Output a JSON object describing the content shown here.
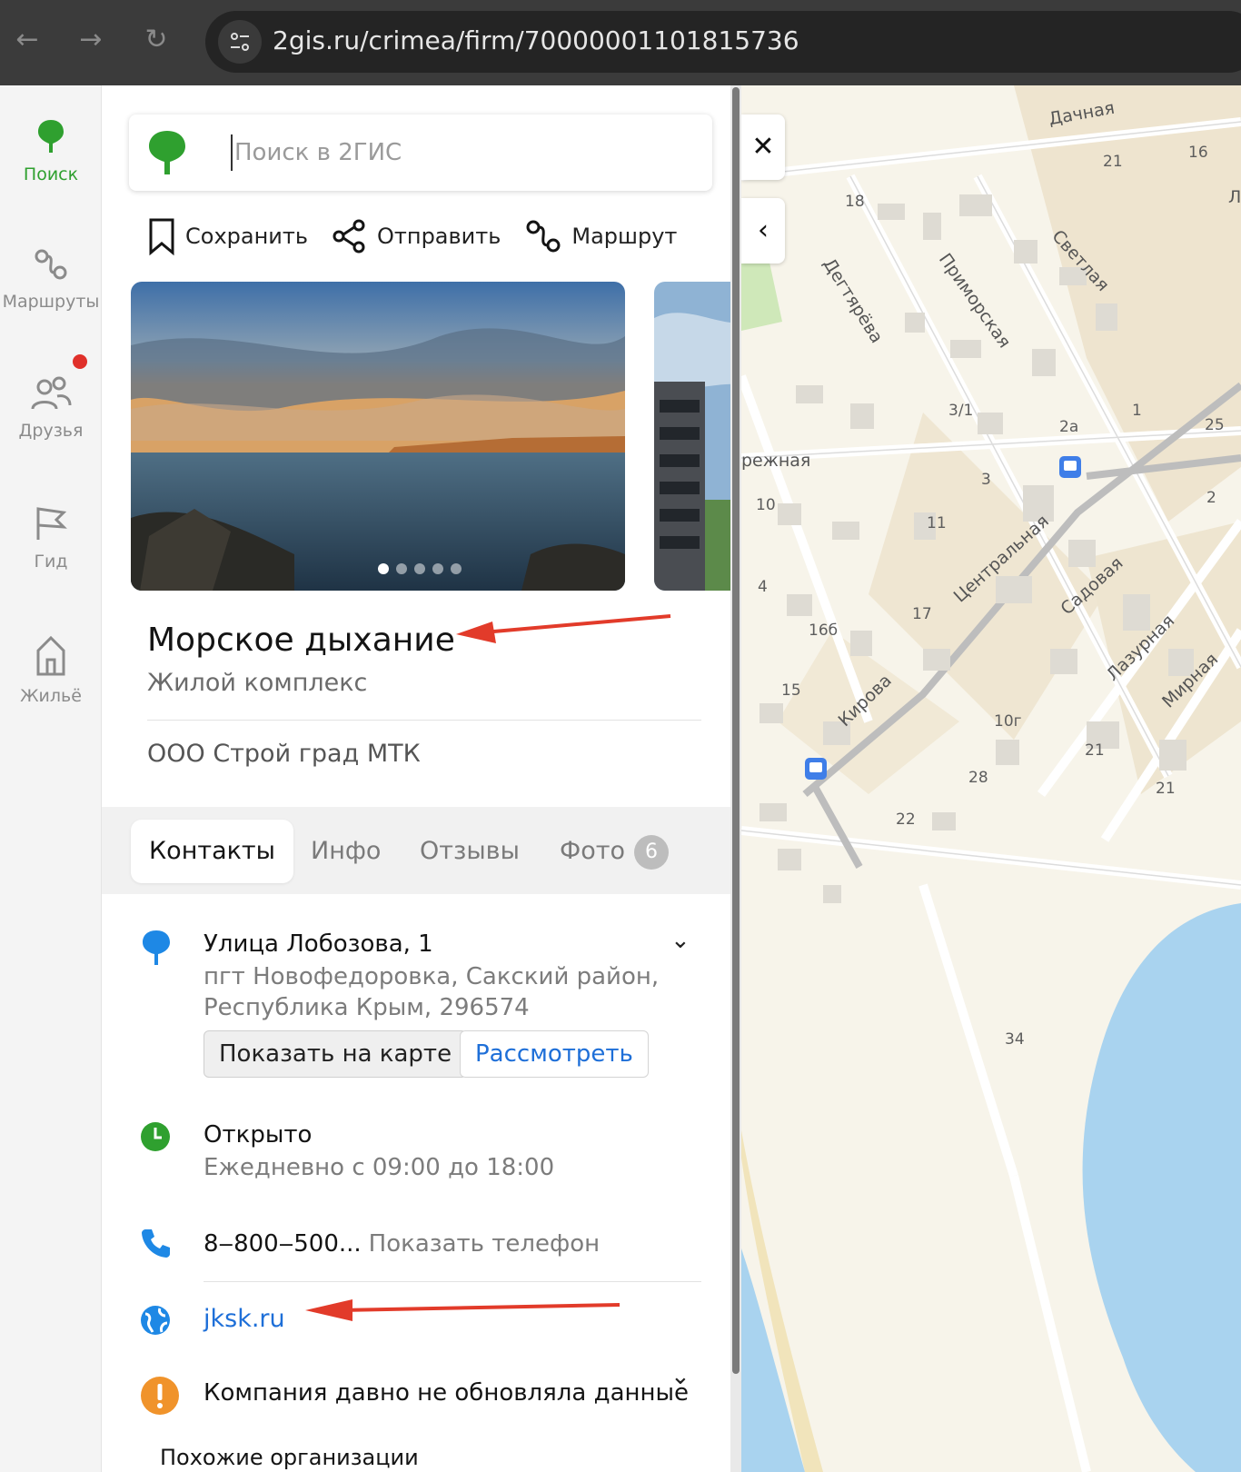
{
  "browser": {
    "url": "2gis.ru/crimea/firm/70000001101815736"
  },
  "rail": {
    "items": [
      {
        "label": "Поиск",
        "icon": "map-pin-icon",
        "active": true
      },
      {
        "label": "Маршруты",
        "icon": "route-icon"
      },
      {
        "label": "Друзья",
        "icon": "friends-icon"
      },
      {
        "label": "Гид",
        "icon": "flag-icon"
      },
      {
        "label": "Жильё",
        "icon": "house-icon"
      }
    ]
  },
  "search": {
    "placeholder": "Поиск в 2ГИС",
    "value": ""
  },
  "actions": {
    "save": "Сохранить",
    "share": "Отправить",
    "route": "Маршрут"
  },
  "firm": {
    "name": "Морское дыхание",
    "category": "Жилой комплекс",
    "org": "ООО Строй град МТК"
  },
  "tabs": [
    {
      "label": "Контакты",
      "active": true
    },
    {
      "label": "Инфо"
    },
    {
      "label": "Отзывы"
    },
    {
      "label": "Фото",
      "count": "6"
    }
  ],
  "contacts": {
    "address": "Улица Лобозова, 1",
    "address_sub": "пгт Новофедоровка, Сакский район, Республика Крым, 296574",
    "show_on_map": "Показать на карте",
    "view": "Рассмотреть",
    "open_status": "Открыто",
    "hours": "Ежедневно с 09:00 до 18:00",
    "phone": "8‒800‒500...",
    "show_phone": "Показать телефон",
    "website": "jksk.ru",
    "warning": "Компания давно не обновляла данные",
    "similar": "Похожие организации"
  },
  "map": {
    "streets": {
      "dachnaya": "Дачная",
      "svetlaya": "Светлая",
      "degtyareva": "Дегтярёва",
      "primorskaya": "Приморская",
      "naberezhnaya": "режная",
      "centralnaya": "Центральная",
      "sadovaya": "Садовая",
      "lazurnaya": "Лазурная",
      "mirnaya": "Мирная",
      "kirova": "Кирова",
      "l_edge": "Л"
    },
    "numbers": [
      "21",
      "16",
      "18",
      "3/1",
      "2а",
      "1",
      "25",
      "3",
      "2",
      "10",
      "11",
      "4",
      "17",
      "16б",
      "15",
      "10г",
      "21",
      "28",
      "21",
      "22",
      "34"
    ]
  },
  "colors": {
    "brand": "#2fa02f",
    "link": "#1e6fd8",
    "warning": "#f0932b",
    "water": "#a9d3ef"
  }
}
